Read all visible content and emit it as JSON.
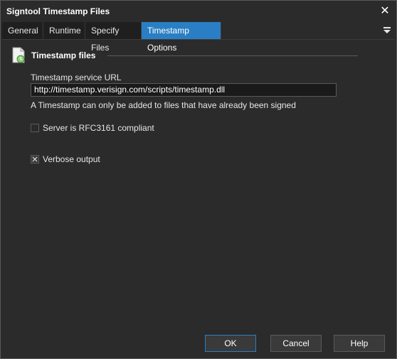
{
  "window": {
    "title": "Signtool Timestamp Files"
  },
  "tabs": [
    {
      "label": "General"
    },
    {
      "label": "Runtime"
    },
    {
      "label": "Specify Files"
    },
    {
      "label": "Timestamp Options",
      "active": true
    }
  ],
  "section": {
    "title": "Timestamp files"
  },
  "url_field": {
    "label": "Timestamp service URL",
    "value": "http://timestamp.verisign.com/scripts/timestamp.dll"
  },
  "hint": "A Timestamp can only be added to files that have already been signed",
  "options": {
    "rfc3161": {
      "label": "Server is RFC3161 compliant",
      "checked": false
    },
    "verbose": {
      "label": "Verbose output",
      "checked": true
    }
  },
  "buttons": {
    "ok": "OK",
    "cancel": "Cancel",
    "help": "Help"
  },
  "colors": {
    "accent": "#2a7fc4",
    "background": "#2b2b2b"
  }
}
